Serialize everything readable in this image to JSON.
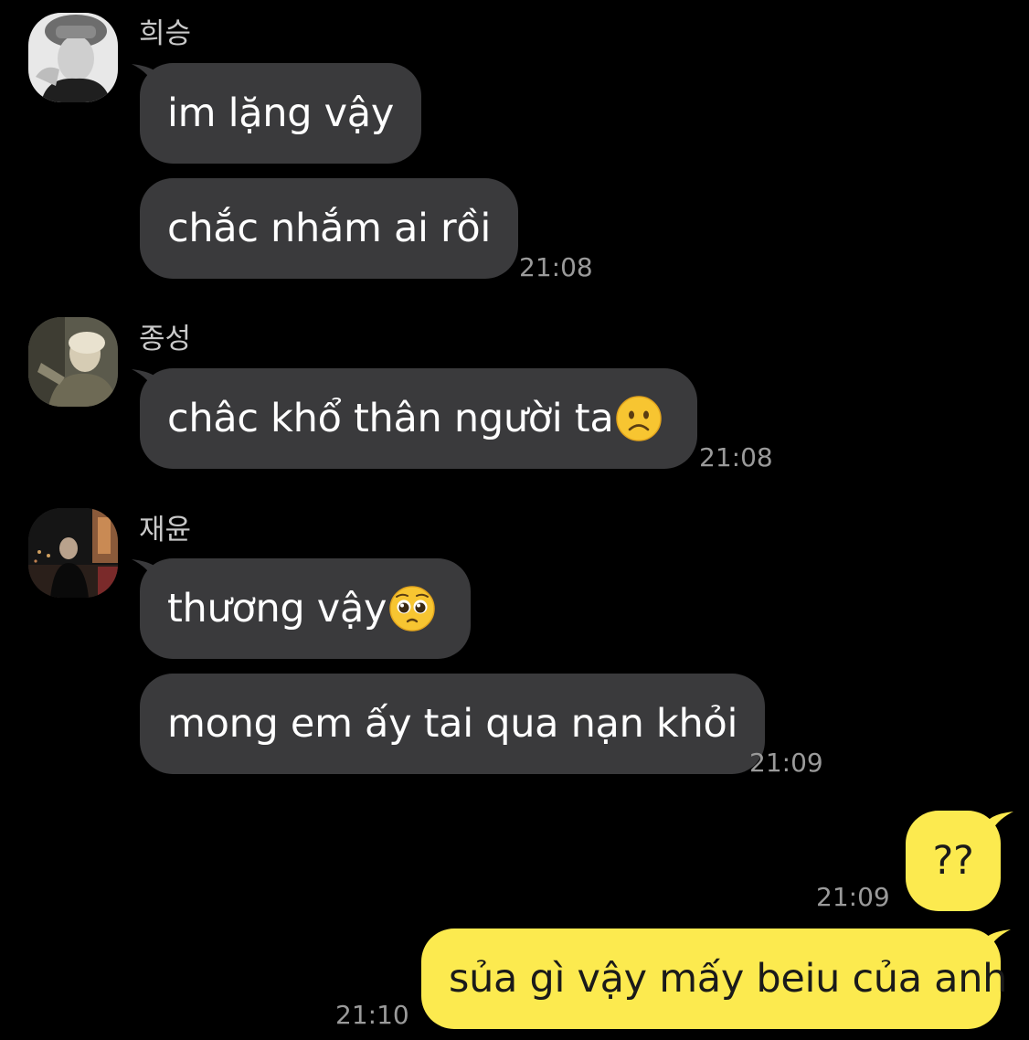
{
  "conversation": [
    {
      "sender": "희승",
      "avatar": "avatar-heeseung",
      "messages": [
        "im lặng vậy",
        "chắc nhắm ai rồi"
      ],
      "time": "21:08"
    },
    {
      "sender": "종성",
      "avatar": "avatar-jongseong",
      "messages": [
        "châc khổ thân người ta"
      ],
      "emoji": "frowning-face-icon",
      "time": "21:08"
    },
    {
      "sender": "재윤",
      "avatar": "avatar-jaeyun",
      "messages": [
        "thương vậy",
        "mong em ấy tai qua nạn khỏi"
      ],
      "emoji": "pleading-face-icon",
      "time": "21:09"
    }
  ],
  "outgoing": [
    {
      "text": "??",
      "time": "21:09"
    },
    {
      "text": "sủa gì vậy mấy beiu của anh",
      "time": "21:10"
    }
  ],
  "colors": {
    "background": "#000000",
    "incoming_bubble": "#3a3a3c",
    "outgoing_bubble": "#fcea4f",
    "timestamp": "#9a9a9a",
    "sender_name": "#c9c9c9"
  }
}
